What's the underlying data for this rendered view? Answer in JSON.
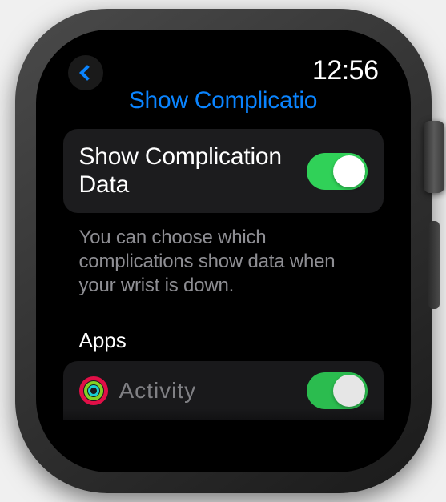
{
  "statusBar": {
    "time": "12:56"
  },
  "header": {
    "title": "Show Complicatio"
  },
  "settings": {
    "mainToggle": {
      "label": "Show Complication Data",
      "enabled": true
    },
    "helpText": "You can choose which complications show data when your wrist is down."
  },
  "appsSection": {
    "header": "Apps",
    "items": [
      {
        "name": "Activity",
        "iconType": "activity-rings",
        "enabled": true
      }
    ]
  },
  "colors": {
    "accent": "#0a84ff",
    "toggleOn": "#30d158",
    "panel": "#1c1c1e",
    "secondaryText": "#8e8e93"
  }
}
